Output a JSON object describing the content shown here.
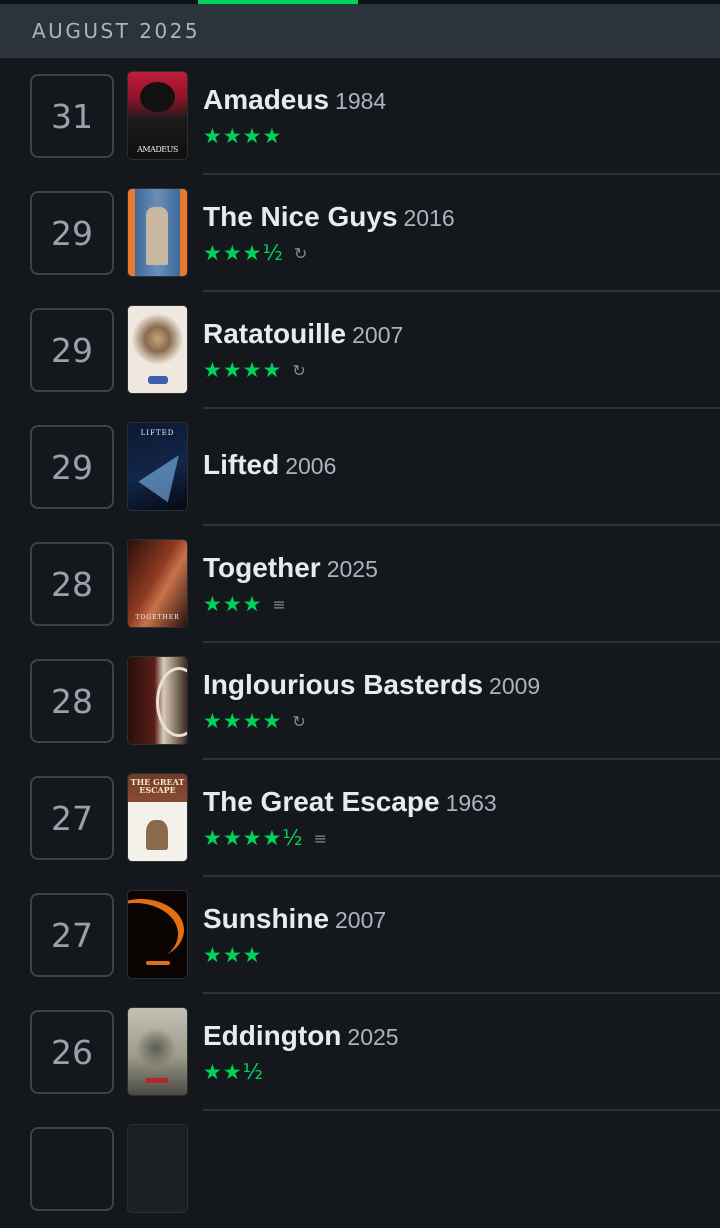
{
  "month_header": "AUGUST 2025",
  "entries": [
    {
      "day": "31",
      "title": "Amadeus",
      "year": "1984",
      "stars": "★★★★",
      "rewatch": false,
      "review": false,
      "poster_caption": "AMADEUS",
      "poster_colors": [
        "#c21c3a",
        "#1a1a1a"
      ]
    },
    {
      "day": "29",
      "title": "The Nice Guys",
      "year": "2016",
      "stars": "★★★½",
      "rewatch": true,
      "review": false,
      "poster_caption": "",
      "poster_colors": [
        "#e9792e",
        "#3b6a9c"
      ]
    },
    {
      "day": "29",
      "title": "Ratatouille",
      "year": "2007",
      "stars": "★★★★",
      "rewatch": true,
      "review": false,
      "poster_caption": "",
      "poster_colors": [
        "#efe8df",
        "#7b5c3f"
      ]
    },
    {
      "day": "29",
      "title": "Lifted",
      "year": "2006",
      "stars": "",
      "rewatch": false,
      "review": false,
      "poster_caption": "LIFTED",
      "poster_colors": [
        "#0b1830",
        "#4f8fc6"
      ]
    },
    {
      "day": "28",
      "title": "Together",
      "year": "2025",
      "stars": "★★★",
      "rewatch": false,
      "review": true,
      "poster_caption": "TOGETHER",
      "poster_colors": [
        "#8e3a22",
        "#2a0f0b"
      ]
    },
    {
      "day": "28",
      "title": "Inglourious Basterds",
      "year": "2009",
      "stars": "★★★★",
      "rewatch": true,
      "review": false,
      "poster_caption": "",
      "poster_colors": [
        "#5a1f18",
        "#d9cbb7"
      ]
    },
    {
      "day": "27",
      "title": "The Great Escape",
      "year": "1963",
      "stars": "★★★★½",
      "rewatch": false,
      "review": true,
      "poster_caption": "THE GREAT ESCAPE",
      "poster_colors": [
        "#6e3b2a",
        "#f4f1ea"
      ]
    },
    {
      "day": "27",
      "title": "Sunshine",
      "year": "2007",
      "stars": "★★★",
      "rewatch": false,
      "review": false,
      "poster_caption": "",
      "poster_colors": [
        "#e36f14",
        "#0a0503"
      ]
    },
    {
      "day": "26",
      "title": "Eddington",
      "year": "2025",
      "stars": "★★½",
      "rewatch": false,
      "review": false,
      "poster_caption": "",
      "poster_colors": [
        "#9c9b8c",
        "#4b4a42"
      ]
    }
  ],
  "icons": {
    "rewatch": "rewatch-icon",
    "review": "review-icon"
  },
  "colors": {
    "accent_green": "#00d35a",
    "background": "#14181d",
    "header": "#2b333c"
  }
}
